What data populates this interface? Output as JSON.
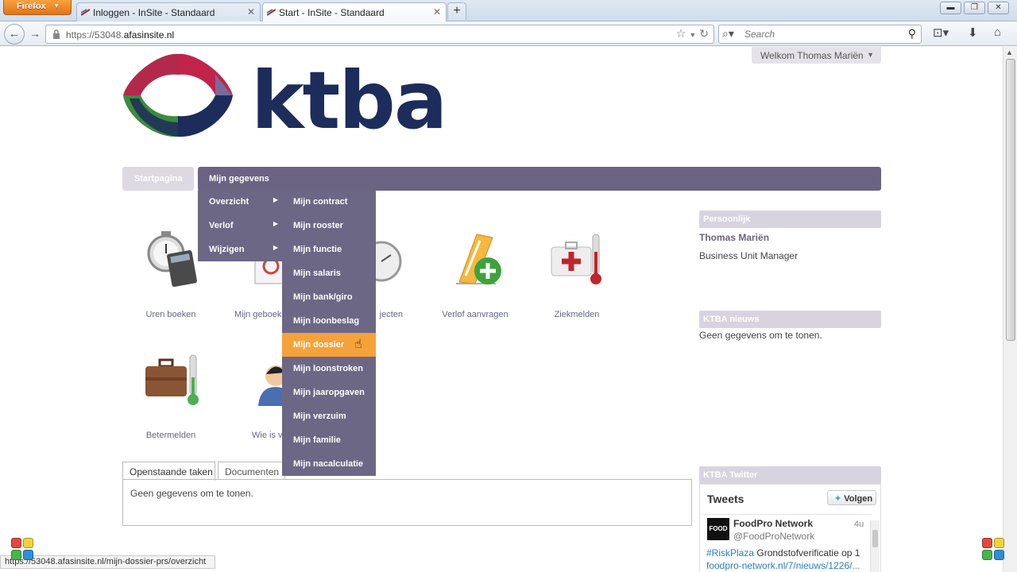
{
  "browser": {
    "app_button": "Firefox",
    "tabs": [
      {
        "title": "Inloggen - InSite - Standaard"
      },
      {
        "title": "Start - InSite - Standaard"
      }
    ],
    "url_prefix": "https://53048.",
    "url_domain": "afasinsite.nl",
    "search_placeholder": "Search",
    "status_url": "https://53048.afasinsite.nl/mijn-dossier-prs/overzicht"
  },
  "header": {
    "welcome": "Welkom Thomas Mariën",
    "logo_text": "ktba"
  },
  "nav": {
    "startpagina": "Startpagina",
    "mijn_gegevens": "Mijn gegevens",
    "submenu": [
      "Overzicht",
      "Verlof",
      "Wijzigen"
    ],
    "dropdown": [
      "Mijn contract",
      "Mijn rooster",
      "Mijn functie",
      "Mijn salaris",
      "Mijn bank/giro",
      "Mijn loonbeslag",
      "Mijn dossier",
      "Mijn loonstroken",
      "Mijn jaaropgaven",
      "Mijn verzuim",
      "Mijn familie",
      "Mijn nacalculatie"
    ],
    "highlighted": "Mijn dossier"
  },
  "apps": {
    "uren_boeken": "Uren boeken",
    "mijn_geboekt": "Mijn geboek",
    "projecten": "jecten",
    "verlof_aanvragen": "Verlof aanvragen",
    "ziekmelden": "Ziekmelden",
    "betermelden": "Betermelden",
    "wie_is": "Wie is v"
  },
  "tasks": {
    "tabs": [
      "Openstaande taken",
      "Documenten"
    ],
    "empty": "Geen gegevens om te tonen."
  },
  "sidebar": {
    "persoonlijk_title": "Persoonlijk",
    "name": "Thomas Mariën",
    "role": "Business Unit Manager",
    "news_title": "KTBA nieuws",
    "news_empty": "Geen gegevens om te tonen.",
    "twitter_title": "KTBA Twitter"
  },
  "twitter": {
    "heading": "Tweets",
    "follow": "Volgen",
    "avatar": "FOOD",
    "name": "FoodPro Network",
    "handle": "@FoodProNetwork",
    "time": "4u",
    "hashtag": "#RiskPlaza",
    "text": " Grondstofverificatie op 1",
    "link": "foodpro-network.nl/7/nieuws/1226/..."
  },
  "colors": {
    "menu_purple": "#6b6382",
    "highlight_orange": "#f5a23a",
    "logo_navy": "#1c2c5b"
  }
}
